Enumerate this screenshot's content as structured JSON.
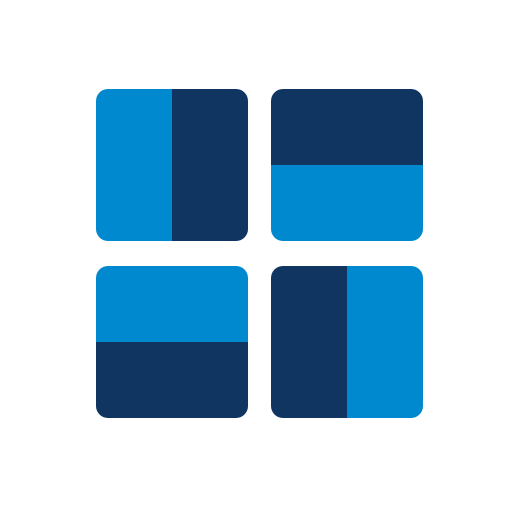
{
  "icon": {
    "name": "four-tile-grid-logo",
    "colors": {
      "light": "#0089CE",
      "dark": "#0F3560",
      "background": "#FFFFFF"
    },
    "tiles": [
      {
        "id": "top-left",
        "split": "vertical",
        "first": "light",
        "second": "dark"
      },
      {
        "id": "top-right",
        "split": "horizontal",
        "first": "dark",
        "second": "light"
      },
      {
        "id": "bottom-left",
        "split": "horizontal",
        "first": "light",
        "second": "dark"
      },
      {
        "id": "bottom-right",
        "split": "vertical",
        "first": "dark",
        "second": "light"
      }
    ]
  }
}
